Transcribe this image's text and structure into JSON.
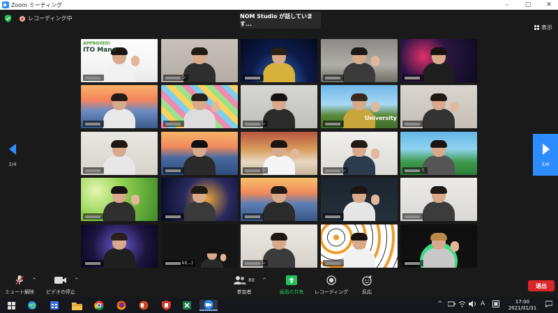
{
  "window": {
    "title": "Zoom ミーティング"
  },
  "topbar": {
    "recording_label": "レコーディング中",
    "speaker_banner": "NOM Studio が話しています...",
    "view_label": "表示"
  },
  "gallery": {
    "page_indicator": "2/4",
    "tiles": [
      {
        "name": ""
      },
      {
        "name": "シ"
      },
      {
        "name": ""
      },
      {
        "name": ""
      },
      {
        "name": ""
      },
      {
        "name": ""
      },
      {
        "name": ""
      },
      {
        "name": "レ"
      },
      {
        "name": ""
      },
      {
        "name": ""
      },
      {
        "name": ""
      },
      {
        "name": ""
      },
      {
        "name": "シ"
      },
      {
        "name": "レ"
      },
      {
        "name": "く"
      },
      {
        "name": ""
      },
      {
        "name": ""
      },
      {
        "name": ""
      },
      {
        "name": ""
      },
      {
        "name": ""
      },
      {
        "name": ""
      },
      {
        "name": "ki(...)"
      },
      {
        "name": "レ"
      },
      {
        "name": ""
      },
      {
        "name": ""
      }
    ],
    "tile_text": {
      "approved": "APPROVED!",
      "ito_manager": "ITO Mana",
      "university": "University"
    }
  },
  "toolbar": {
    "mute_label": "ミュート解除",
    "video_label": "ビデオの停止",
    "participants_label": "参加者",
    "participants_count": "80",
    "share_label": "画面の共有",
    "record_label": "レコーディング",
    "reactions_label": "反応",
    "leave_label": "退出"
  },
  "taskbar": {
    "ime_label": "A",
    "time": "17:00",
    "date": "2021/01/31"
  },
  "colors": {
    "zoom_blue": "#2d8cff",
    "share_green": "#22c25c",
    "leave_red": "#d9262a"
  }
}
